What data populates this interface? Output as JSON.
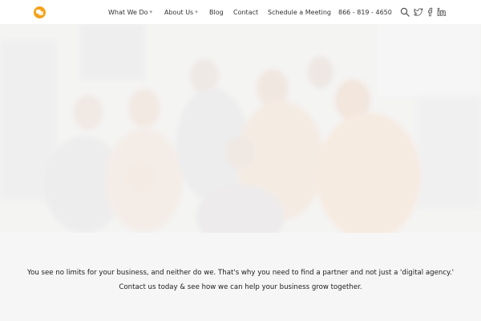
{
  "nav": {
    "items": [
      {
        "label": "What We Do",
        "has_dropdown": true
      },
      {
        "label": "About Us",
        "has_dropdown": true
      },
      {
        "label": "Blog"
      },
      {
        "label": "Contact"
      },
      {
        "label": "Schedule a Meeting"
      }
    ],
    "phone": "866 - 819 - 4650",
    "icons": [
      "search-icon",
      "twitter-icon",
      "facebook-icon",
      "linkedin-icon"
    ],
    "chevron": "▾"
  },
  "hero": {
    "image": "faded group photo of team"
  },
  "intro": {
    "line1": "You see no limits for your business, and neither do we. That's why you need to find a partner and not just a 'digital agency.'",
    "line2": "Contact us today & see how we can help your business grow together."
  },
  "colors": {
    "accent": "#f5a21b",
    "nav_bg": "#ffffff",
    "section_bg": "#f6f6f6"
  }
}
